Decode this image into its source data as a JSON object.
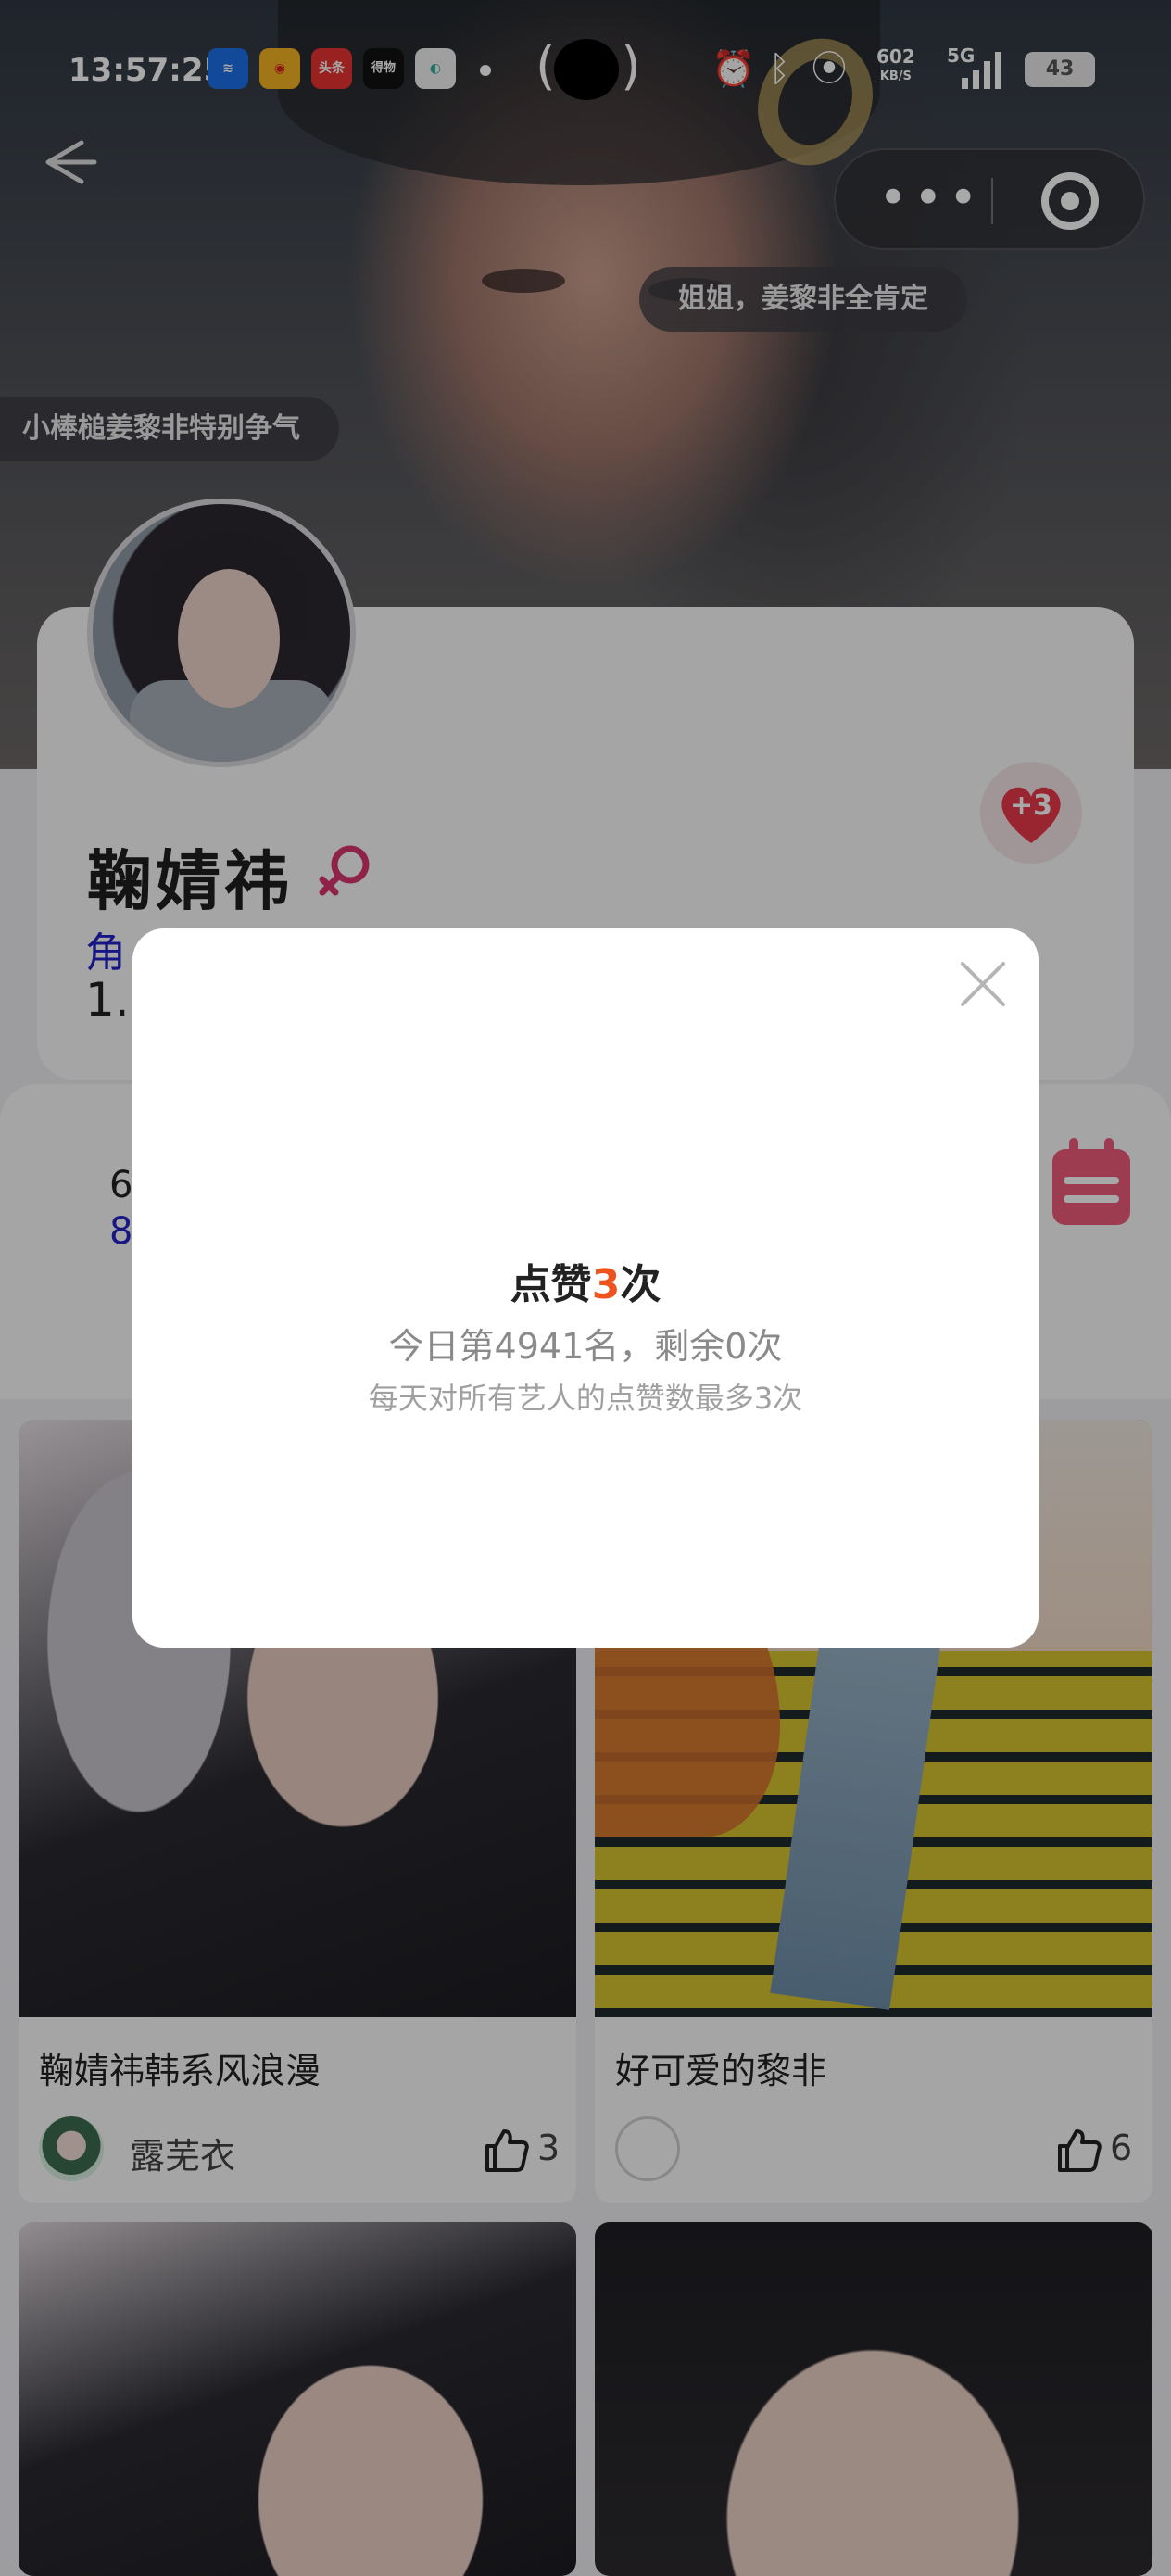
{
  "status_bar": {
    "time": "13:57:25",
    "apps": [
      "wifi-app",
      "weibo",
      "头条",
      "得物",
      "browser"
    ],
    "toutiao_label": "头条",
    "dewu_label": "得物",
    "net_speed": "602",
    "net_unit": "KB/S",
    "network": "5G",
    "battery": "43"
  },
  "hero": {
    "danmu_right": "姐姐，姜黎非全肯定",
    "danmu_left": "小棒槌姜黎非特别争气"
  },
  "profile": {
    "name": "鞠婧祎",
    "gender_icon": "female-icon",
    "role_label": "角",
    "fans_value": "1.3",
    "like_badge": "+3"
  },
  "stats": {
    "value_top": "6",
    "value_bottom": "8"
  },
  "posts": [
    {
      "title": "鞠婧祎韩系风浪漫",
      "author": "露芜衣",
      "likes": "3"
    },
    {
      "title": "好可爱的黎非",
      "author": "",
      "likes": "6"
    },
    {
      "title": "",
      "author": "",
      "likes": ""
    },
    {
      "title": "",
      "author": "",
      "likes": ""
    }
  ],
  "modal": {
    "title_prefix": "点赞",
    "title_count": "3",
    "title_suffix": "次",
    "rank_line": "今日第4941名，剩余0次",
    "limit_line": "每天对所有艺人的点赞数最多3次"
  },
  "colors": {
    "accent": "#f0541e",
    "heart": "#e8394a",
    "link_blue": "#2323c8",
    "gender_pink": "#d9356e"
  }
}
